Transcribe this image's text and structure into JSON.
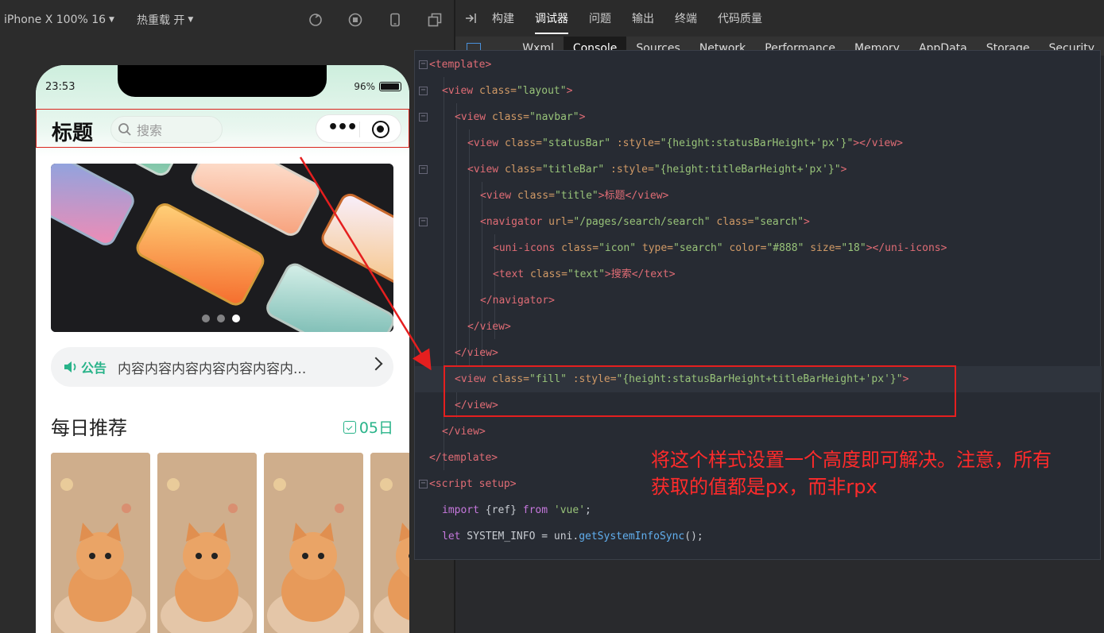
{
  "toolbar": {
    "device": "iPhone X 100% 16",
    "hot_reload": "热重载 开"
  },
  "phone": {
    "time": "23:53",
    "battery": "96%",
    "title": "标题",
    "search_placeholder": "搜索",
    "notice_label": "公告",
    "notice_text": "内容内容内容内容内容内容内...",
    "rec_title": "每日推荐",
    "rec_date": "05日"
  },
  "devtools": {
    "top_tabs": [
      "构建",
      "调试器",
      "问题",
      "输出",
      "终端",
      "代码质量"
    ],
    "active_tab": "调试器",
    "sub_tabs": [
      "Wxml",
      "Console",
      "Sources",
      "Network",
      "Performance",
      "Memory",
      "AppData",
      "Storage",
      "Security"
    ],
    "active_sub": "Console"
  },
  "code": {
    "l1": "<template>",
    "l2a": "<view",
    "l2b": " class=",
    "l2c": "\"layout\"",
    "l2d": ">",
    "l3a": "<view",
    "l3b": " class=",
    "l3c": "\"navbar\"",
    "l3d": ">",
    "l4a": "<view",
    "l4b": " class=",
    "l4c": "\"statusBar\"",
    "l4d": " :style=",
    "l4e": "\"{height:statusBarHeight+'px'}\"",
    "l4f": "></view>",
    "l5a": "<view",
    "l5b": " class=",
    "l5c": "\"titleBar\"",
    "l5d": " :style=",
    "l5e": "\"{height:titleBarHeight+'px'}\"",
    "l5f": ">",
    "l6a": "<view",
    "l6b": " class=",
    "l6c": "\"title\"",
    "l6d": ">标题</view>",
    "l7a": "<navigator",
    "l7b": " url=",
    "l7c": "\"/pages/search/search\"",
    "l7d": " class=",
    "l7e": "\"search\"",
    "l7f": ">",
    "l8a": "<uni-icons",
    "l8b": " class=",
    "l8c": "\"icon\"",
    "l8d": " type=",
    "l8e": "\"search\"",
    "l8f": " color=",
    "l8g": "\"#888\"",
    "l8h": " size=",
    "l8i": "\"18\"",
    "l8j": "></uni-icons>",
    "l9a": "<text",
    "l9b": " class=",
    "l9c": "\"text\"",
    "l9d": ">搜索</text>",
    "l10": "</navigator>",
    "l11": "</view>",
    "l12": "</view>",
    "l13a": "<view",
    "l13b": " class=",
    "l13c": "\"fill\"",
    "l13d": " :style=",
    "l13e": "\"{height:statusBarHeight+titleBarHeight+'px'}\"",
    "l13f": ">",
    "l14": "</view>",
    "l15": "</view>",
    "l16": "</template>",
    "l17": "<script setup>",
    "l18a": "import",
    "l18b": " {ref} ",
    "l18c": "from",
    "l18d": " 'vue'",
    "l18e": ";",
    "l19a": "let",
    "l19b": " SYSTEM_INFO = uni.",
    "l19c": "getSystemInfoSync",
    "l19d": "();"
  },
  "annotation": {
    "line1": "将这个样式设置一个高度即可解决。注意，所有",
    "line2": "获取的值都是px，而非rpx"
  },
  "colors": {
    "accent": "#28b389",
    "highlight_box": "#e51f1f"
  }
}
